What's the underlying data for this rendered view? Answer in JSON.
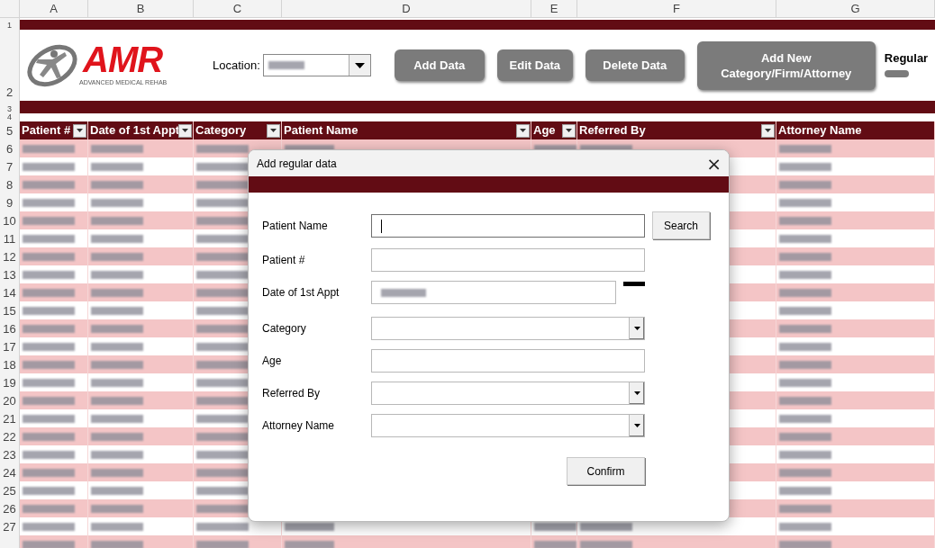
{
  "sheet": {
    "column_letters": [
      "A",
      "B",
      "C",
      "D",
      "E",
      "F",
      "G"
    ],
    "row_numbers": [
      "1",
      "2",
      "3",
      "4",
      "5",
      "6",
      "7",
      "8",
      "9",
      "10",
      "11",
      "12",
      "13",
      "14",
      "15",
      "16",
      "17",
      "18",
      "19",
      "20",
      "21",
      "22",
      "23",
      "24",
      "25",
      "26",
      "27"
    ],
    "header": {
      "logo": {
        "text": "AMR",
        "tagline": "ADVANCED MEDICAL REHAB"
      },
      "location_label": "Location:",
      "buttons": [
        {
          "label": "Add Data"
        },
        {
          "label": "Edit Data"
        },
        {
          "label": "Delete Data"
        },
        {
          "label": "Add New Category/Firm/Attorney"
        }
      ],
      "mode_label": "Regular",
      "mode_toggle": {
        "on": false
      }
    },
    "table": {
      "columns": [
        {
          "label": "Patient #"
        },
        {
          "label": "Date of 1st Appt"
        },
        {
          "label": "Category"
        },
        {
          "label": "Patient Name"
        },
        {
          "label": "Age"
        },
        {
          "label": "Referred By"
        },
        {
          "label": "Attorney Name"
        }
      ]
    }
  },
  "dialog": {
    "title": "Add regular data",
    "close": "×",
    "fields": [
      {
        "label": "Patient Name",
        "kind": "text",
        "focused": true
      },
      {
        "label": "Patient #",
        "kind": "text",
        "focused": false
      },
      {
        "label": "Date of 1st Appt",
        "kind": "date",
        "focused": false
      },
      {
        "label": "Category",
        "kind": "select",
        "focused": false
      },
      {
        "label": "Age",
        "kind": "text",
        "focused": false
      },
      {
        "label": "Referred By",
        "kind": "select",
        "focused": false
      },
      {
        "label": "Attorney Name",
        "kind": "select",
        "focused": false
      }
    ],
    "search_button": "Search",
    "confirm_button": "Confirm"
  }
}
